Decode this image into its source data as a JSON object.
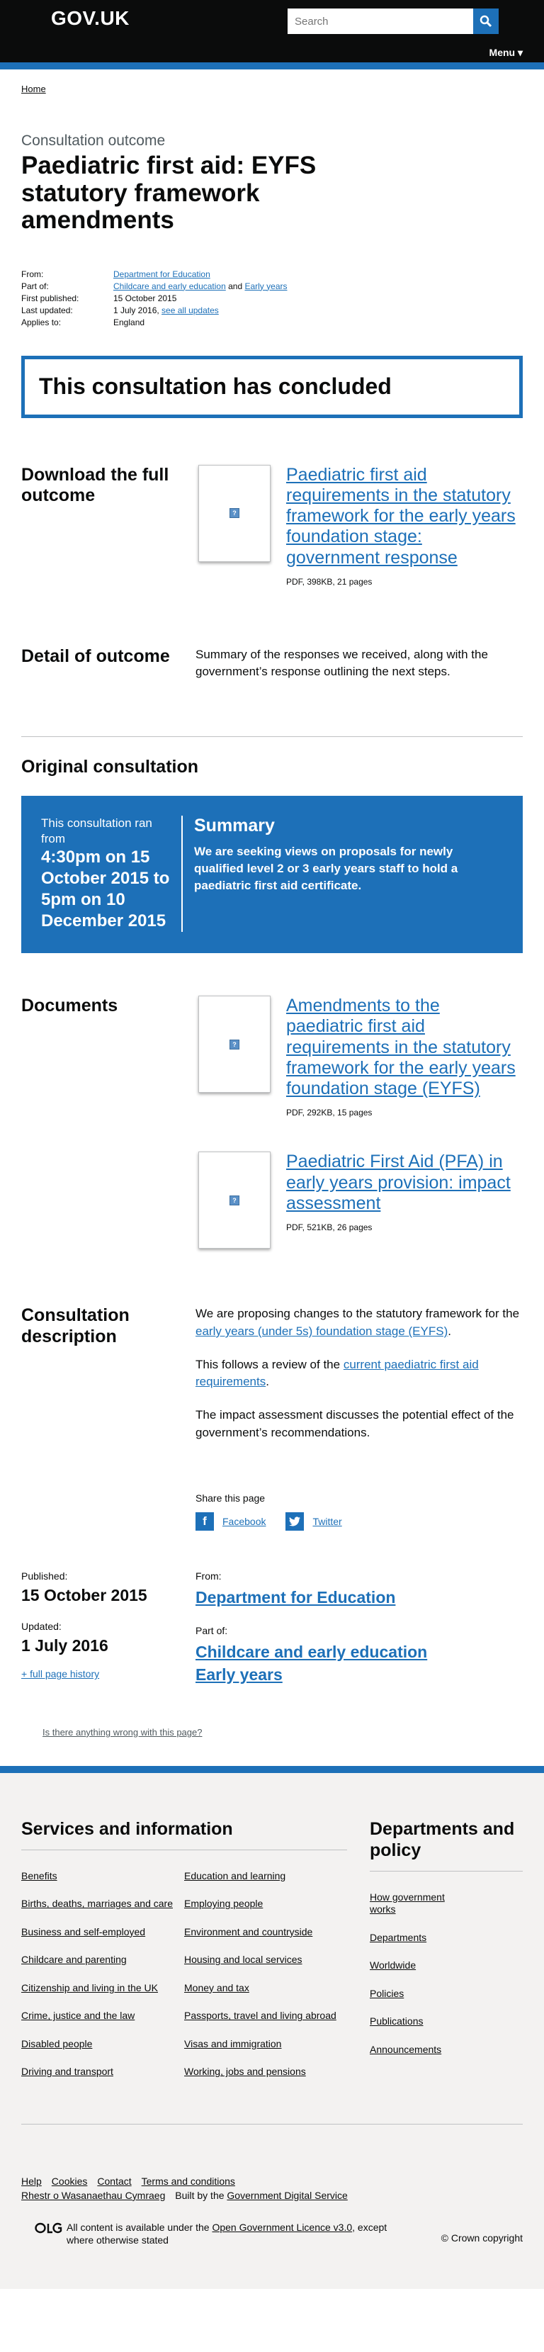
{
  "header": {
    "logo": "GOV.UK",
    "search_placeholder": "Search",
    "menu_label": "Menu ▾"
  },
  "breadcrumb": {
    "home": "Home"
  },
  "page": {
    "context": "Consultation outcome",
    "title": "Paediatric first aid: EYFS statutory framework amendments"
  },
  "metadata": {
    "from_label": "From:",
    "from_value": "Department for Education",
    "part_of_label": "Part of:",
    "part_of_1": "Childcare and early education",
    "part_of_and": " and ",
    "part_of_2": "Early years",
    "first_published_label": "First published:",
    "first_published_value": "15 October 2015",
    "last_updated_label": "Last updated:",
    "last_updated_value": "1 July 2016, ",
    "see_all_updates": "see all updates",
    "applies_to_label": "Applies to:",
    "applies_to_value": "England"
  },
  "notice": {
    "text": "This consultation has concluded"
  },
  "outcome": {
    "heading": "Download the full outcome",
    "attachment_title": "Paediatric first aid requirements in the statutory framework for the early years foundation stage: government response",
    "attachment_meta": "PDF, 398KB, 21 pages"
  },
  "detail": {
    "heading": "Detail of outcome",
    "text": "Summary of the responses we received, along with the government’s response outlining the next steps."
  },
  "original": {
    "heading": "Original consultation",
    "ran_from": "This consultation ran from",
    "dates": "4:30pm on 15 October 2015 to 5pm on 10 December 2015",
    "summary_heading": "Summary",
    "summary_text": "We are seeking views on proposals for newly qualified level 2 or 3 early years staff to hold a paediatric first aid certificate."
  },
  "documents": {
    "heading": "Documents",
    "items": [
      {
        "title": "Amendments to the paediatric first aid requirements in the statutory framework for the early years foundation stage (EYFS)",
        "meta": "PDF, 292KB, 15 pages"
      },
      {
        "title": "Paediatric First Aid (PFA) in early years provision: impact assessment",
        "meta": "PDF, 521KB, 26 pages"
      }
    ]
  },
  "description": {
    "heading": "Consultation description",
    "p1_start": "We are proposing changes to the statutory framework for the ",
    "p1_link": "early years (under 5s) foundation stage (EYFS)",
    "p1_end": ".",
    "p2_start": "This follows a review of the ",
    "p2_link": "current paediatric first aid requirements",
    "p2_end": ".",
    "p3": "The impact assessment discusses the potential effect of the government’s recommendations."
  },
  "share": {
    "title": "Share this page",
    "facebook": "Facebook",
    "twitter": "Twitter"
  },
  "bottom_meta": {
    "published_label": "Published:",
    "published_value": "15 October 2015",
    "updated_label": "Updated:",
    "updated_value": "1 July 2016",
    "history_link": "+ full page history",
    "from_label": "From:",
    "from_value": "Department for Education",
    "part_of_label": "Part of:",
    "part_of_1": "Childcare and early education",
    "part_of_2": "Early years"
  },
  "feedback": {
    "link": "Is there anything wrong with this page?"
  },
  "footer": {
    "services_heading": "Services and information",
    "services_col1": [
      "Benefits",
      "Births, deaths, marriages and care",
      "Business and self-employed",
      "Childcare and parenting",
      "Citizenship and living in the UK",
      "Crime, justice and the law",
      "Disabled people",
      "Driving and transport"
    ],
    "services_col2": [
      "Education and learning",
      "Employing people",
      "Environment and countryside",
      "Housing and local services",
      "Money and tax",
      "Passports, travel and living abroad",
      "Visas and immigration",
      "Working, jobs and pensions"
    ],
    "departments_heading": "Departments and policy",
    "departments": [
      "How government works",
      "Departments",
      "Worldwide",
      "Policies",
      "Publications",
      "Announcements"
    ],
    "meta_links": [
      "Help",
      "Cookies",
      "Contact",
      "Terms and conditions"
    ],
    "welsh": "Rhestr o Wasanaethau Cymraeg",
    "built_by": "Built by the ",
    "gds": "Government Digital Service",
    "licence_start": "All content is available under the ",
    "licence_link": "Open Government Licence v3.0",
    "licence_end": ", except where otherwise stated",
    "copyright": "© Crown copyright"
  }
}
